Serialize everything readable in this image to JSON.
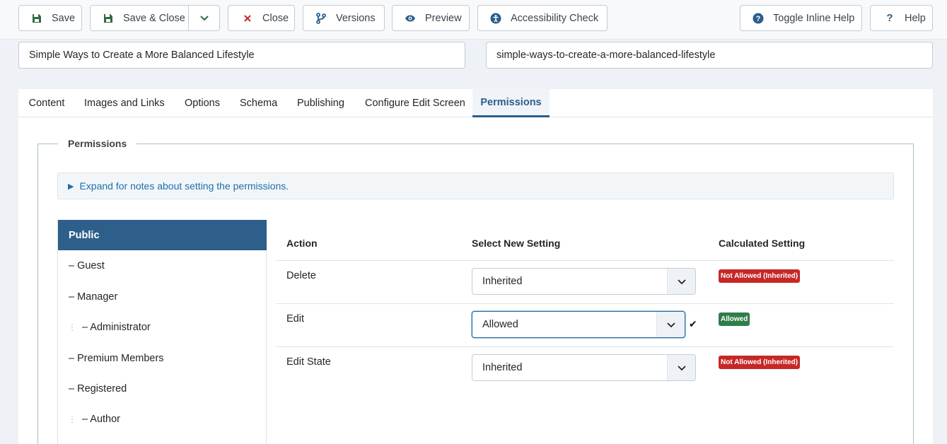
{
  "toolbar": {
    "save": "Save",
    "save_close": "Save & Close",
    "close": "Close",
    "versions": "Versions",
    "preview": "Preview",
    "accessibility": "Accessibility Check",
    "inline_help": "Toggle Inline Help",
    "help": "Help"
  },
  "article": {
    "title": "Simple Ways to Create a More Balanced Lifestyle",
    "alias": "simple-ways-to-create-a-more-balanced-lifestyle"
  },
  "tabs": [
    "Content",
    "Images and Links",
    "Options",
    "Schema",
    "Publishing",
    "Configure Edit Screen",
    "Permissions"
  ],
  "permissions": {
    "legend": "Permissions",
    "notes": "Expand for notes about setting the permissions.",
    "groups": [
      "Public",
      "– Guest",
      "– Manager",
      "– Administrator",
      "– Premium Members",
      "– Registered",
      "– Author"
    ],
    "headers": {
      "action": "Action",
      "select": "Select New Setting",
      "calculated": "Calculated Setting"
    },
    "rows": [
      {
        "action": "Delete",
        "setting": "Inherited",
        "calculated": "Not Allowed (Inherited)"
      },
      {
        "action": "Edit",
        "setting": "Allowed",
        "calculated": "Allowed"
      },
      {
        "action": "Edit State",
        "setting": "Inherited",
        "calculated": "Not Allowed (Inherited)"
      }
    ]
  },
  "colors": {
    "primary": "#2d5f8a",
    "save_green": "#2f7d4a",
    "close_red": "#c52827",
    "link_blue": "#1f6ea8"
  }
}
